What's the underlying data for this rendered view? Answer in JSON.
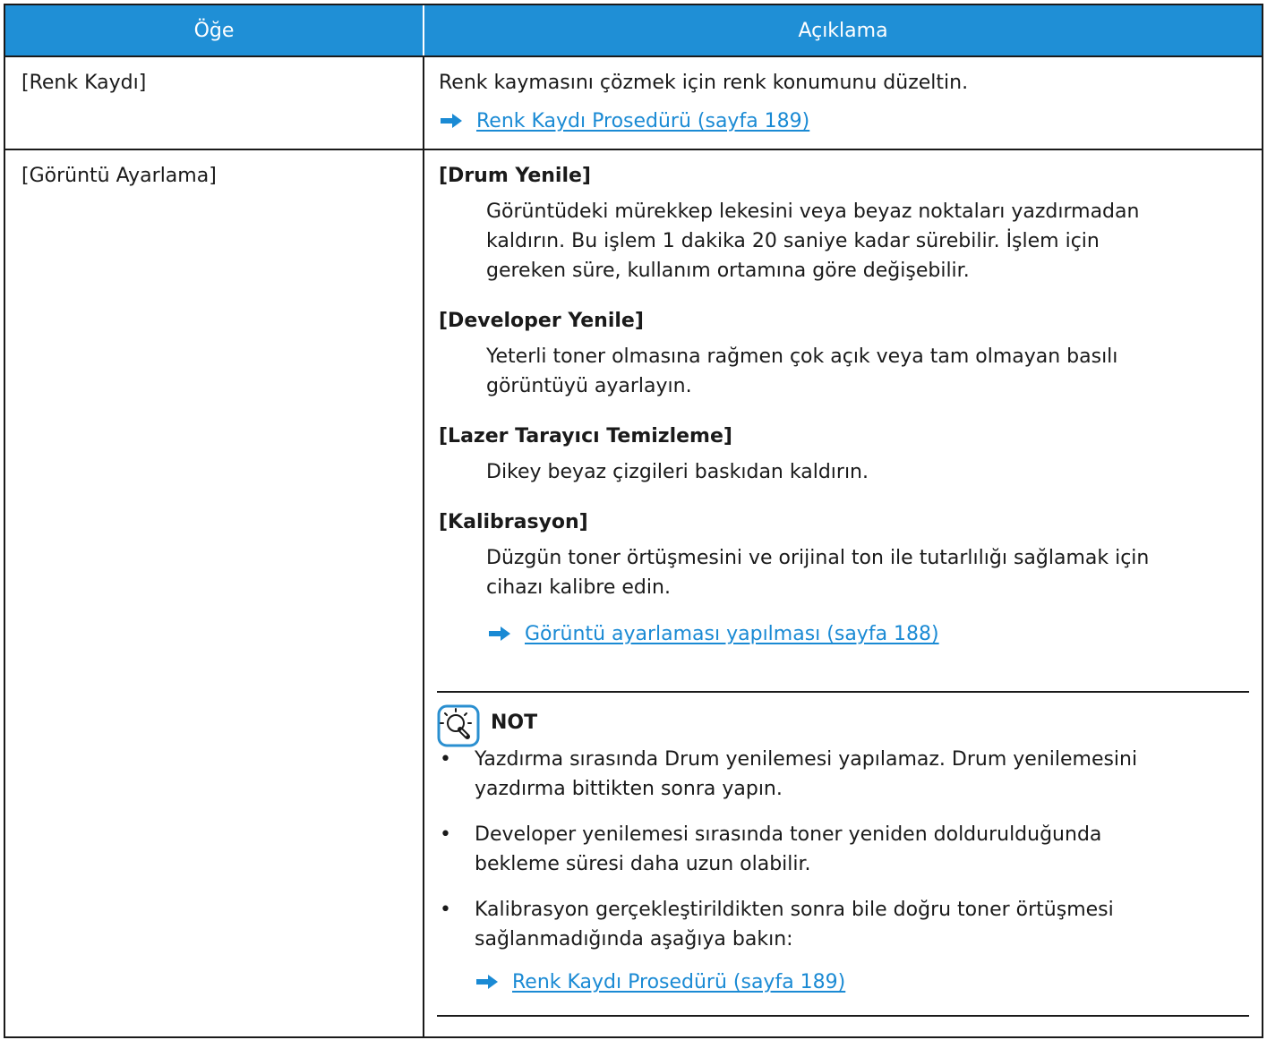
{
  "header": {
    "col1": "Öğe",
    "col2": "Açıklama"
  },
  "rows": [
    {
      "item": "[Renk Kaydı]",
      "desc": "Renk kaymasını çözmek için renk konumunu düzeltin.",
      "link": "Renk Kaydı Prosedürü (sayfa 189)"
    },
    {
      "item": "[Görüntü Ayarlama]",
      "sections": [
        {
          "title": "[Drum Yenile]",
          "lines": [
            "Görüntüdeki mürekkep lekesini veya beyaz noktaları yazdırmadan",
            "kaldırın. Bu işlem 1 dakika 20 saniye kadar sürebilir. İşlem için",
            "gereken süre, kullanım ortamına göre değişebilir."
          ]
        },
        {
          "title": "[Developer Yenile]",
          "lines": [
            "Yeterli toner olmasına rağmen çok açık veya tam olmayan basılı",
            "görüntüyü ayarlayın."
          ]
        },
        {
          "title": "[Lazer Tarayıcı Temizleme]",
          "lines": [
            "Dikey beyaz çizgileri baskıdan kaldırın."
          ]
        },
        {
          "title": "[Kalibrasyon]",
          "lines": [
            "Düzgün toner örtüşmesini ve orijinal ton ile tutarlılığı sağlamak için",
            "cihazı kalibre edin."
          ],
          "link": "Görüntü ayarlaması yapılması (sayfa 188)"
        }
      ],
      "note": {
        "title": "NOT",
        "bullets": [
          [
            "Yazdırma sırasında Drum yenilemesi yapılamaz. Drum yenilemesini",
            "yazdırma bittikten sonra yapın."
          ],
          [
            "Developer yenilemesi sırasında toner yeniden doldurulduğunda",
            "bekleme süresi daha uzun olabilir."
          ],
          [
            "Kalibrasyon gerçekleştirildikten sonra bile doğru toner örtüşmesi",
            "sağlanmadığında aşağıya bakın:"
          ]
        ],
        "link": "Renk Kaydı Prosedürü (sayfa 189)"
      }
    }
  ],
  "colors": {
    "header_bg": "#1f8fd6",
    "link": "#1a8ad4",
    "note_icon": "#2a8fd0"
  },
  "icons": {
    "link_arrow": "arrow-right-icon",
    "note": "lightbulb-note-icon"
  }
}
